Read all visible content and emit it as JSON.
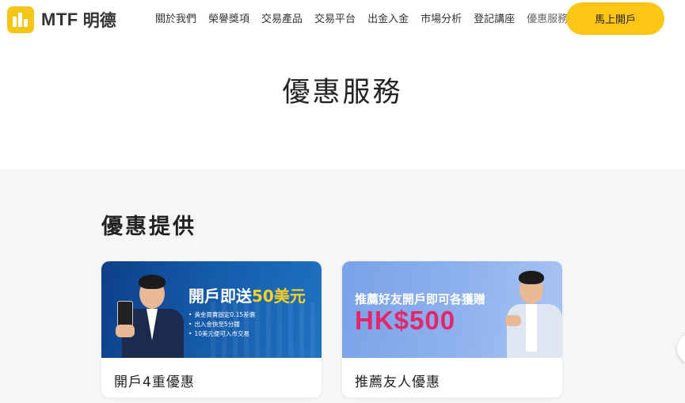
{
  "header": {
    "logo_text": "MTF",
    "logo_cn": "明德",
    "nav": [
      {
        "label": "關於我們"
      },
      {
        "label": "榮譽獎項"
      },
      {
        "label": "交易產品"
      },
      {
        "label": "交易平台"
      },
      {
        "label": "出金入金"
      },
      {
        "label": "市場分析"
      },
      {
        "label": "登記講座"
      },
      {
        "label": "優惠服務"
      }
    ],
    "cta_label": "馬上開戶"
  },
  "hero": {
    "title": "優惠服務"
  },
  "offers": {
    "title": "優惠提供",
    "cards": [
      {
        "label": "開戶4重優惠",
        "banner": {
          "headline_prefix": "開戶即送",
          "headline_amount": "50美元",
          "bullets": [
            "黃金買賣固定0.15差價",
            "出入金快至5分鐘",
            "10美元便可入市交易"
          ]
        }
      },
      {
        "label": "推薦友人優惠",
        "banner": {
          "headline": "推薦好友開戶即可各獲贈",
          "amount": "HK$500"
        }
      }
    ]
  },
  "colors": {
    "brand_yellow": "#fcc614",
    "banner1_blue": "#155aa8",
    "banner2_blue": "#8fb2ee",
    "amount_pink": "#e5266c"
  }
}
